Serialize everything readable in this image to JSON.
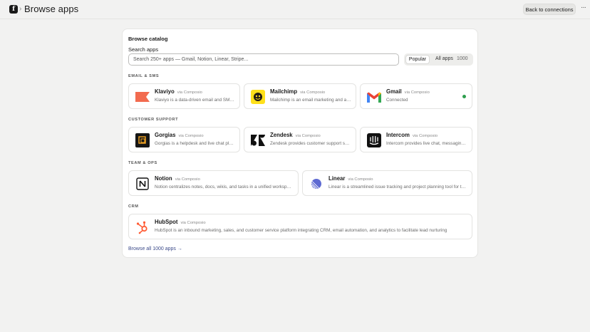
{
  "header": {
    "logo_glyph": "f",
    "separator": "›",
    "title": "Browse apps",
    "back_button": "Back to connections",
    "more": "···"
  },
  "catalog": {
    "title": "Browse catalog",
    "search_label": "Search apps",
    "search_placeholder": "Search 250+ apps — Gmail, Notion, Linear, Stripe...",
    "filter_popular": "Popular",
    "filter_all": "All apps",
    "filter_all_count": "1000",
    "browse_all": "Browse all 1000 apps →"
  },
  "sections": [
    {
      "title": "EMAIL & SMS",
      "apps": [
        {
          "name": "Klaviyo",
          "via": "via Composio",
          "desc": "Klaviyo is a data-driven email and SMS marketing platform",
          "icon": "klaviyo-flag-icon",
          "color": "#f26b4f"
        },
        {
          "name": "Mailchimp",
          "via": "via Composio",
          "desc": "Mailchimp is an email marketing and automation platform",
          "icon": "mailchimp-icon",
          "color": "#ffe01b"
        },
        {
          "name": "Gmail",
          "via": "via Composio",
          "desc": "Connected",
          "icon": "gmail-icon",
          "status_color": "#2e9e4e"
        }
      ]
    },
    {
      "title": "CUSTOMER SUPPORT",
      "apps": [
        {
          "name": "Gorgias",
          "via": "via Composio",
          "desc": "Gorgias is a helpdesk and live chat platform",
          "icon": "gorgias-icon",
          "color": "#161616"
        },
        {
          "name": "Zendesk",
          "via": "via Composio",
          "desc": "Zendesk provides customer support software",
          "icon": "zendesk-icon",
          "color": "#03363d"
        },
        {
          "name": "Intercom",
          "via": "via Composio",
          "desc": "Intercom provides live chat, messaging and support",
          "icon": "intercom-icon",
          "color": "#111111"
        }
      ]
    },
    {
      "title": "TEAM & OPS",
      "apps": [
        {
          "name": "Notion",
          "via": "via Composio",
          "desc": "Notion centralizes notes, docs, wikis, and tasks in a unified workspace",
          "icon": "notion-icon",
          "color": "#111111"
        },
        {
          "name": "Linear",
          "via": "via Composio",
          "desc": "Linear is a streamlined issue tracking and project planning tool for teams",
          "icon": "linear-icon",
          "color": "#5e6ad2"
        }
      ]
    },
    {
      "title": "CRM",
      "apps": [
        {
          "name": "HubSpot",
          "via": "via Composio",
          "desc": "HubSpot is an inbound marketing, sales, and customer service platform integrating CRM, email automation, and analytics to facilitate lead nurturing",
          "icon": "hubspot-icon",
          "color": "#ff5c35"
        }
      ]
    }
  ]
}
